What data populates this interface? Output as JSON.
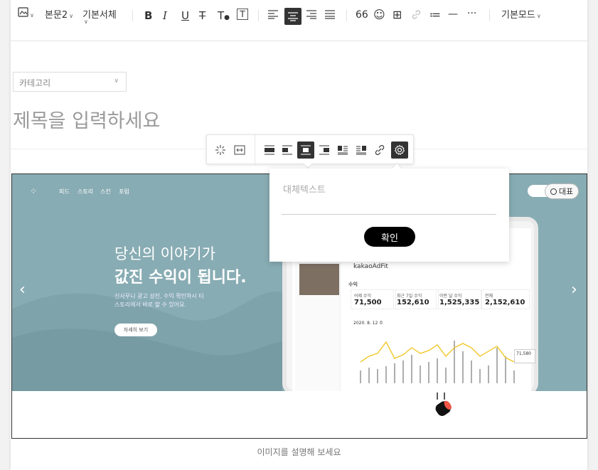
{
  "toolbar": {
    "image_icon": "image-icon",
    "paragraph_style": "본문2",
    "font_family": "기본서체",
    "bold": "B",
    "italic": "I",
    "underline": "U",
    "strike": "T",
    "text_color": "T",
    "text_bg": "T",
    "quote": "66",
    "emoji": "☺",
    "table": "⊞",
    "link": "🔗",
    "list": "≔",
    "hr": "—",
    "more": "···",
    "mode": "기본모드"
  },
  "editor": {
    "category": "카테고리",
    "title_placeholder": "제목을 입력하세요",
    "caption_placeholder": "이미지를 설명해 보세요"
  },
  "banner": {
    "nav": [
      "피드",
      "스토리",
      "스킨",
      "포럼"
    ],
    "headline1": "당신의 이야기가",
    "headline2": "값진 수익이 됩니다.",
    "sub": "신사무니 광고 성진, 수익 확인하시 티스토리에서 바로 할 수 있어요.",
    "button": "자세히 보기",
    "represent_label": "대표",
    "tablet": {
      "brand": "kakaoAdFit",
      "section": "수익",
      "cards": [
        {
          "label": "어제 수익",
          "value": "71,500"
        },
        {
          "label": "최근 7일 수익",
          "value": "152,610"
        },
        {
          "label": "이번 달 수익",
          "value": "1,525,335"
        },
        {
          "label": "전체",
          "value": "2,152,610"
        }
      ],
      "date": "2020. 8. 12 수",
      "tag": "71,580"
    }
  },
  "image_toolbar": {
    "icons": [
      "sparkle-icon",
      "resize-width-icon",
      "align-full-icon",
      "align-left-wrap-icon",
      "align-center-icon",
      "align-right-wrap-icon",
      "float-left-icon",
      "float-right-icon",
      "link-icon",
      "settings-icon"
    ]
  },
  "alt_popup": {
    "placeholder": "대체텍스트",
    "confirm": "확인"
  }
}
